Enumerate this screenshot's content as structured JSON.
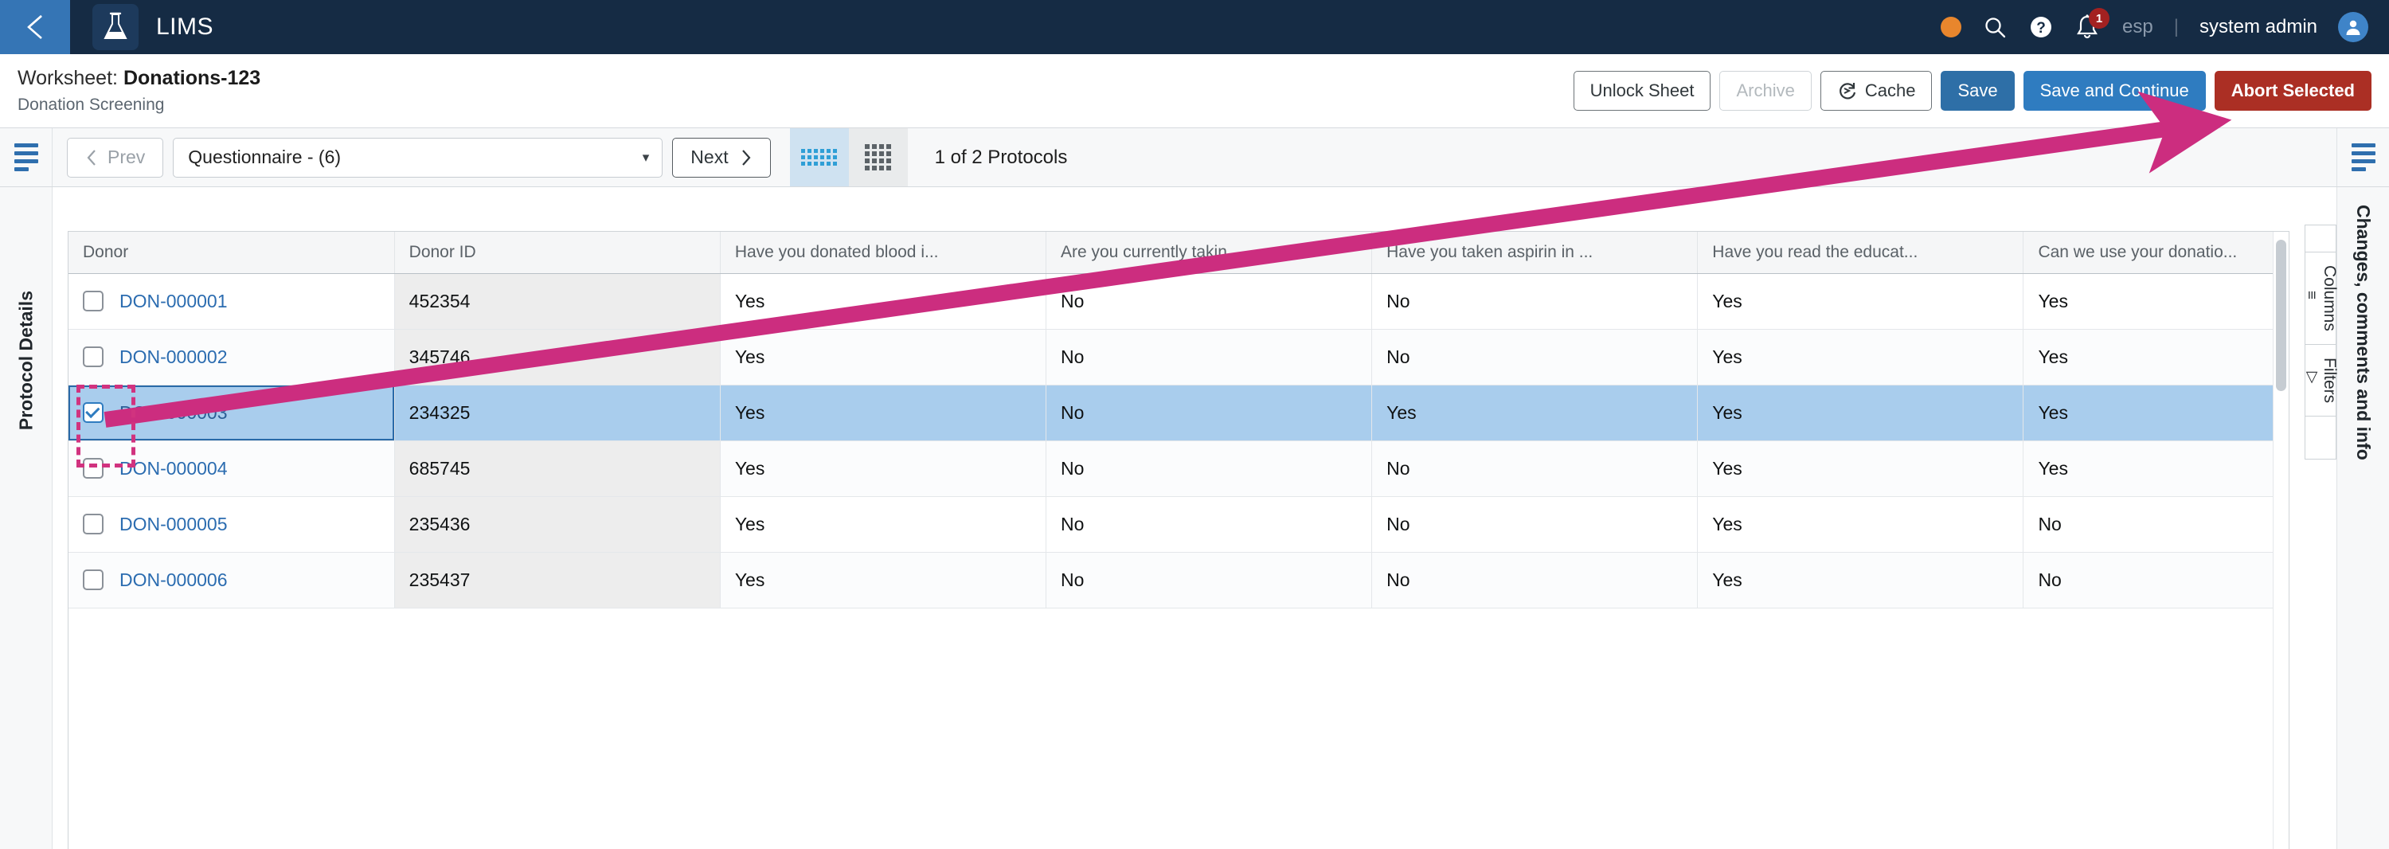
{
  "topbar": {
    "back_icon": "chevron-left-icon",
    "logo_icon": "flask-icon",
    "app_title": "LIMS",
    "status_dot_color": "#e8862d",
    "search_icon": "search-icon",
    "help_icon": "help-circle-icon",
    "notification_icon": "bell-icon",
    "notification_count": "1",
    "locale": "esp",
    "divider": "|",
    "user_name": "system admin",
    "avatar_icon": "user-avatar-icon"
  },
  "worksheet": {
    "title_prefix": "Worksheet:",
    "title_name": "Donations-123",
    "subtitle": "Donation Screening",
    "actions": {
      "unlock": "Unlock Sheet",
      "archive": "Archive",
      "cache": "Cache",
      "cache_icon": "refresh-icon",
      "save": "Save",
      "save_continue": "Save and Continue",
      "abort": "Abort Selected"
    }
  },
  "toolbar": {
    "menu_icon": "hamburger-menu-icon",
    "prev": "Prev",
    "prev_icon": "chevron-left-icon",
    "protocol_selected": "Questionnaire - (6)",
    "dropdown_icon": "chevron-down-icon",
    "next": "Next",
    "next_icon": "chevron-right-icon",
    "view_compact_icon": "compact-grid-icon",
    "view_grid_icon": "grid-icon",
    "protocol_count": "1 of 2 Protocols",
    "right_menu_icon": "hamburger-menu-icon"
  },
  "rails": {
    "left_label": "Protocol Details",
    "right_label": "Changes, comments and info",
    "tabs": [
      {
        "label": "Columns",
        "icon": "columns-icon"
      },
      {
        "label": "Filters",
        "icon": "filter-icon"
      }
    ]
  },
  "table": {
    "columns": [
      "Donor",
      "Donor ID",
      "Have you donated blood i...",
      "Are you currently takin...",
      "Have you taken aspirin in ...",
      "Have you read the educat...",
      "Can we use your donatio..."
    ],
    "rows": [
      {
        "selected": false,
        "checked": false,
        "donor": "DON-000001",
        "donor_id": "452354",
        "answers": [
          "Yes",
          "No",
          "No",
          "Yes",
          "Yes"
        ]
      },
      {
        "selected": false,
        "checked": false,
        "donor": "DON-000002",
        "donor_id": "345746",
        "answers": [
          "Yes",
          "No",
          "No",
          "Yes",
          "Yes"
        ]
      },
      {
        "selected": true,
        "checked": true,
        "donor": "DON-000003",
        "donor_id": "234325",
        "answers": [
          "Yes",
          "No",
          "Yes",
          "Yes",
          "Yes"
        ]
      },
      {
        "selected": false,
        "checked": false,
        "donor": "DON-000004",
        "donor_id": "685745",
        "answers": [
          "Yes",
          "No",
          "No",
          "Yes",
          "Yes"
        ]
      },
      {
        "selected": false,
        "checked": false,
        "donor": "DON-000005",
        "donor_id": "235436",
        "answers": [
          "Yes",
          "No",
          "No",
          "Yes",
          "No"
        ]
      },
      {
        "selected": false,
        "checked": false,
        "donor": "DON-000006",
        "donor_id": "235437",
        "answers": [
          "Yes",
          "No",
          "No",
          "Yes",
          "No"
        ]
      }
    ]
  },
  "annotation": {
    "arrow_color": "#cc2d7f",
    "highlight_color": "#d1337f",
    "from": "donor-row-checkbox",
    "to": "abort-selected-button"
  }
}
